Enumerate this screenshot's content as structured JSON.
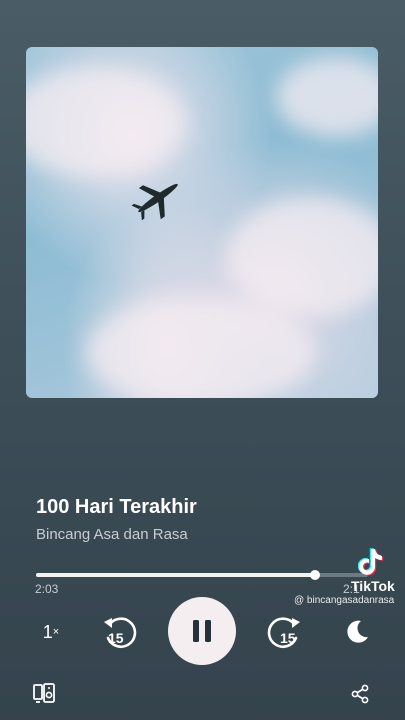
{
  "episode": {
    "title": "100 Hari Terakhir",
    "show": "Bincang Asa dan Rasa"
  },
  "playback": {
    "elapsed": "2:03",
    "remaining": "2:1",
    "progress_fraction": 0.84,
    "speed_value": "1",
    "speed_suffix": "×",
    "skip_back_seconds": "15",
    "skip_forward_seconds": "15",
    "state": "playing"
  },
  "watermark": {
    "brand": "TikTok",
    "handle": "@ bincangasadanrasa"
  },
  "icons": [
    "airplane-in-artwork",
    "rewind-15-icon",
    "pause-icon",
    "forward-15-icon",
    "moon-sleep-timer-icon",
    "connect-device-icon",
    "share-icon",
    "tiktok-logo-icon"
  ],
  "colors": {
    "background": "#3e4f59",
    "play_button": "#f4eef1",
    "progress_fill": "#f2f2f2",
    "progress_track": "#6d7b84"
  }
}
